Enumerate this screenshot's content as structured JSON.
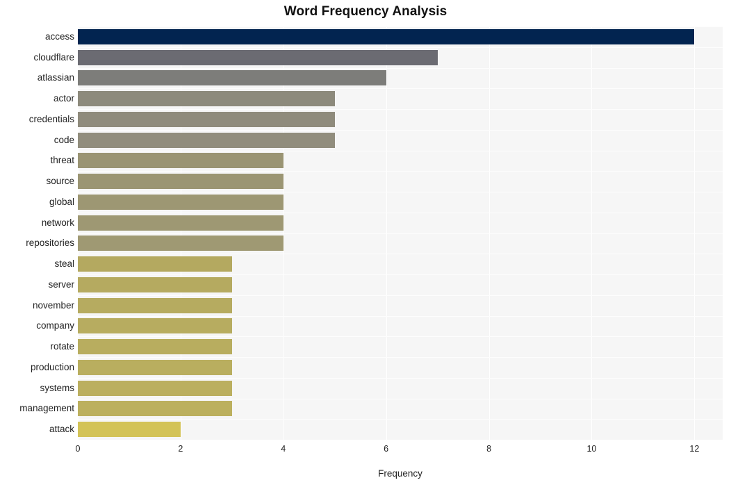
{
  "chart_data": {
    "type": "bar",
    "orientation": "horizontal",
    "title": "Word Frequency Analysis",
    "xlabel": "Frequency",
    "ylabel": "",
    "xlim": [
      0,
      12.55
    ],
    "xticks": [
      0,
      2,
      4,
      6,
      8,
      10,
      12
    ],
    "xtick_labels": [
      "0",
      "2",
      "4",
      "6",
      "8",
      "10",
      "12"
    ],
    "grid": true,
    "legend": "none",
    "plot_background": "#f6f6f6",
    "figure_background": "#ffffff",
    "categories": [
      "access",
      "cloudflare",
      "atlassian",
      "actor",
      "credentials",
      "code",
      "threat",
      "source",
      "global",
      "network",
      "repositories",
      "steal",
      "server",
      "november",
      "company",
      "rotate",
      "production",
      "systems",
      "management",
      "attack"
    ],
    "values": [
      12,
      7,
      6,
      5,
      5,
      5,
      4,
      4,
      4,
      4,
      4,
      3,
      3,
      3,
      3,
      3,
      3,
      3,
      3,
      2
    ],
    "bar_colors": [
      "#022450",
      "#6b6b72",
      "#7d7d7a",
      "#8d8a7c",
      "#8f8b7c",
      "#918d7d",
      "#9a9473",
      "#9b9573",
      "#9d9773",
      "#9e9873",
      "#9f9973",
      "#b4a960",
      "#b5aa60",
      "#b6ab60",
      "#b7ac60",
      "#b8ad5f",
      "#b9ae5f",
      "#bbaf5f",
      "#bcb05e",
      "#d3c357"
    ]
  }
}
